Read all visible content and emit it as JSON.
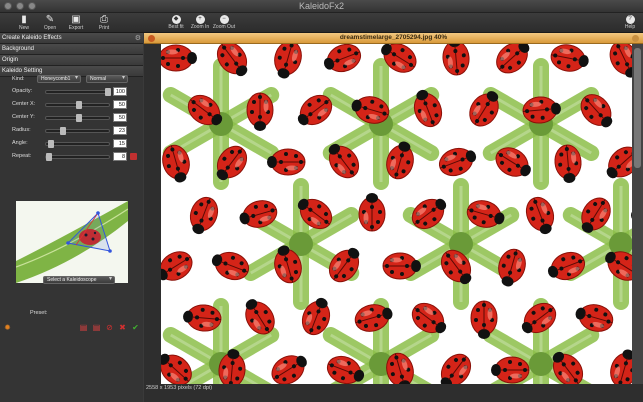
{
  "window": {
    "title": "KaleidoFx2"
  },
  "toolbar": {
    "new_label": "New",
    "open_label": "Open",
    "export_label": "Export",
    "print_label": "Print",
    "bestfit_label": "Best fit",
    "zoomin_label": "Zoom In",
    "zoomout_label": "Zoom Out",
    "help_label": "Help"
  },
  "sections": {
    "create": "Create Kaleido Effects",
    "background": "Background",
    "origin": "Origin",
    "setting": "Kaleido Setting"
  },
  "settings": {
    "kind_label": "Kind:",
    "kind_value": "Honeycomb1",
    "blend_value": "Normal",
    "rows": [
      {
        "label": "Opacity:",
        "value": "100",
        "pos": 1.0
      },
      {
        "label": "Center X:",
        "value": "50",
        "pos": 0.5
      },
      {
        "label": "Center Y:",
        "value": "50",
        "pos": 0.5
      },
      {
        "label": "Radius:",
        "value": "23",
        "pos": 0.23
      },
      {
        "label": "Angle:",
        "value": "15",
        "pos": 0.04
      },
      {
        "label": "Repeat:",
        "value": "8",
        "pos": 0.0
      }
    ]
  },
  "preset": {
    "label": "Preset:",
    "value": "Select a Kaleidoscope"
  },
  "document": {
    "title": "dreamstimelarge_2705294.jpg 40%",
    "status": "2558 x 1953 pixels (72 dpi)"
  },
  "colors": {
    "accent": "#e8a948",
    "ladybug": "#d42418",
    "leaf": "#8cbf4a"
  },
  "icons": {
    "new": "new-document-icon",
    "open": "open-folder-icon",
    "export": "export-icon",
    "print": "printer-icon",
    "best_fit": "best-fit-icon",
    "zoom_in": "zoom-in-icon",
    "zoom_out": "zoom-out-icon",
    "help": "help-icon"
  }
}
